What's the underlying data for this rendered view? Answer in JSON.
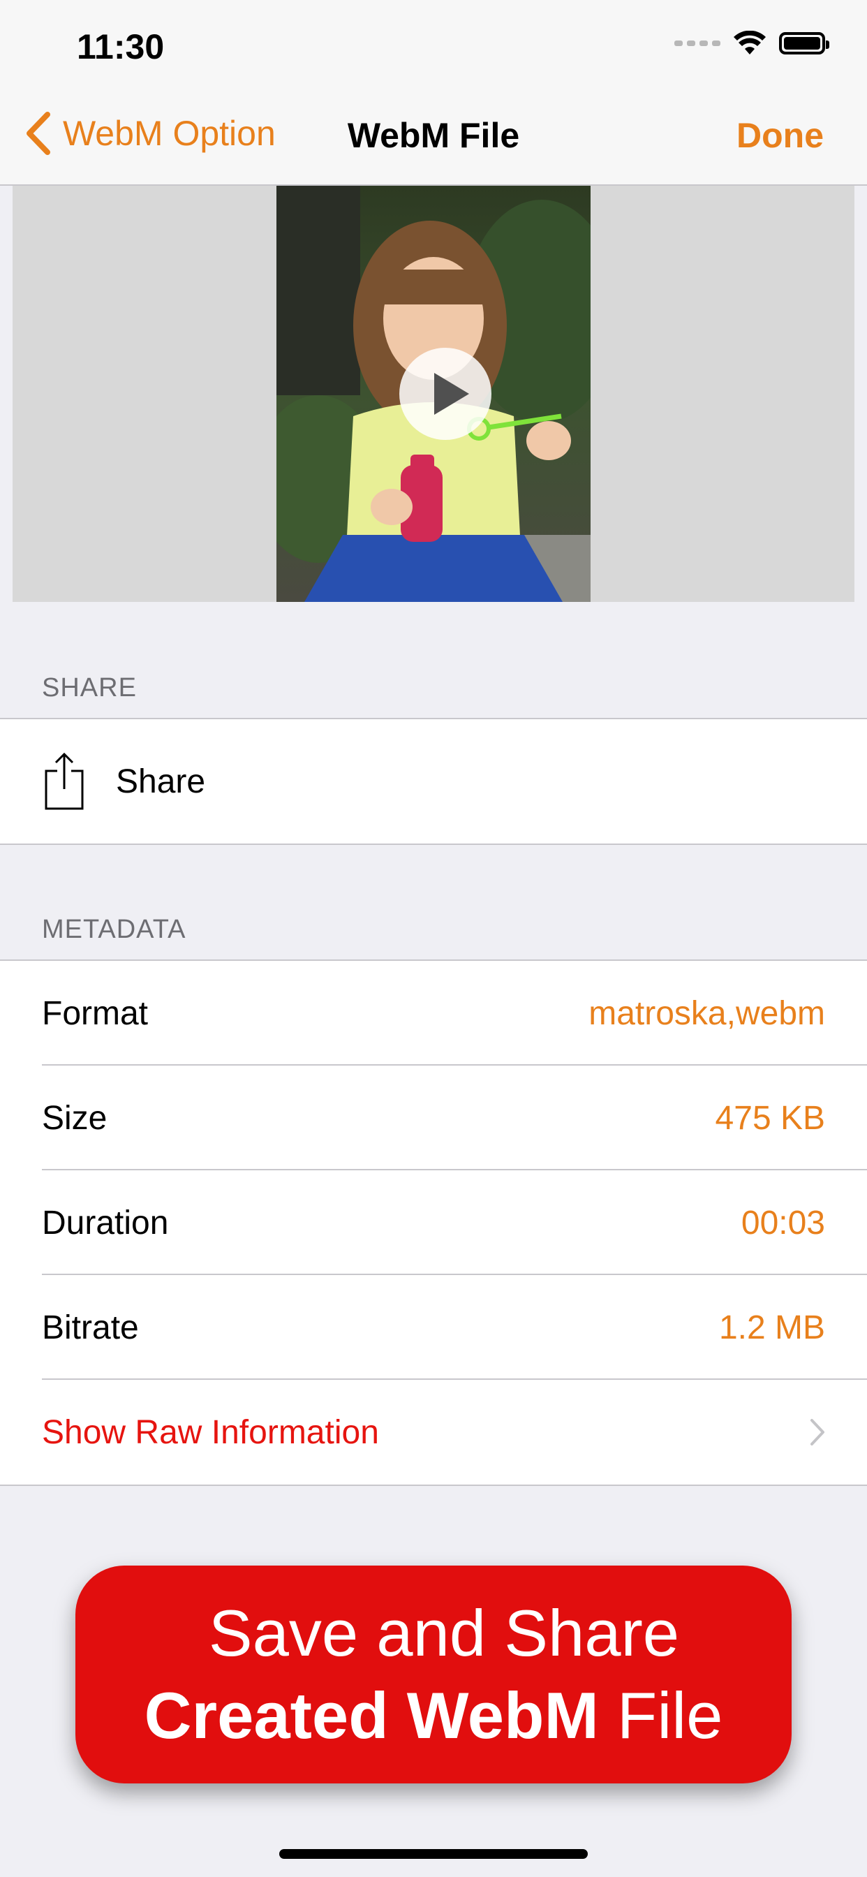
{
  "status_bar": {
    "time": "11:30"
  },
  "nav": {
    "back_label": "WebM Option",
    "title": "WebM File",
    "done_label": "Done"
  },
  "sections": {
    "share_header": "SHARE",
    "share_label": "Share",
    "metadata_header": "METADATA"
  },
  "metadata": {
    "format_label": "Format",
    "format_value": "matroska,webm",
    "size_label": "Size",
    "size_value": "475 KB",
    "duration_label": "Duration",
    "duration_value": "00:03",
    "bitrate_label": "Bitrate",
    "bitrate_value": "1.2 MB",
    "raw_info_label": "Show Raw Information"
  },
  "cta": {
    "line1": "Save and Share",
    "line2_bold": "Created WebM",
    "line2_rest": " File"
  },
  "colors": {
    "accent": "#e8801c",
    "link_red": "#e6140f",
    "cta_red": "#e10e0e"
  },
  "icons": {
    "back": "chevron-left-icon",
    "play": "play-icon",
    "share": "share-icon",
    "chevron": "chevron-right-icon",
    "wifi": "wifi-icon",
    "battery": "battery-icon"
  }
}
